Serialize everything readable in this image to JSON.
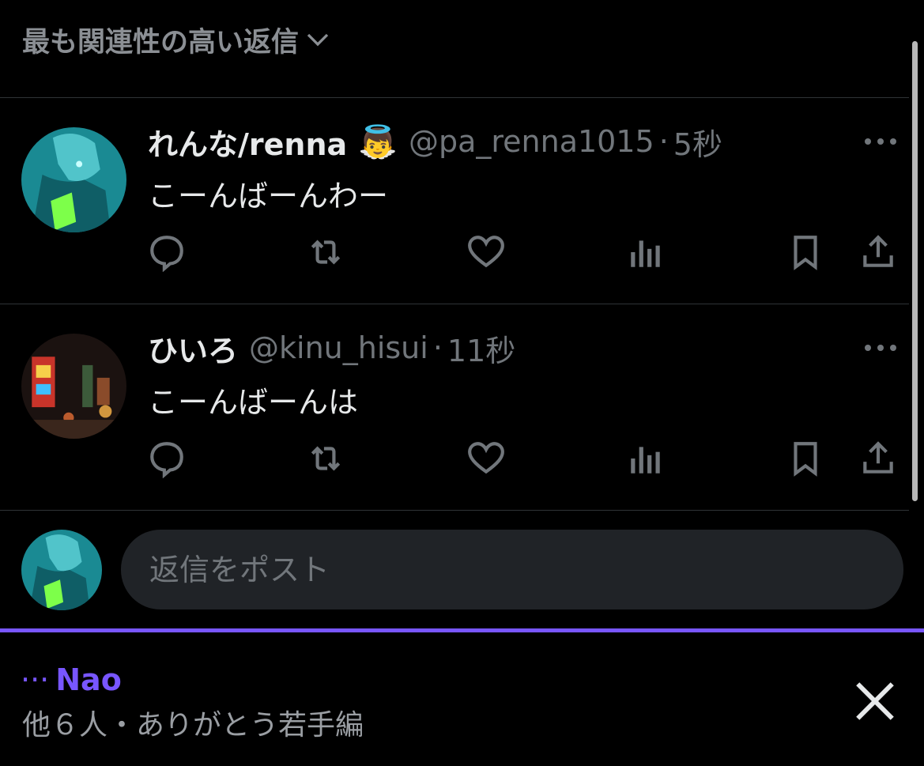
{
  "sort": {
    "label": "最も関連性の高い返信",
    "icon": "chevron-down-icon"
  },
  "tweets": [
    {
      "name": "れんな/renna",
      "emoji": "👼",
      "handle": "@pa_renna1015",
      "sep": "·",
      "time": "5秒",
      "text": "こーんばーんわー"
    },
    {
      "name": "ひいろ",
      "emoji": "",
      "handle": "@kinu_hisui",
      "sep": "·",
      "time": "11秒",
      "text": "こーんばーんは"
    }
  ],
  "reply": {
    "placeholder": "返信をポスト"
  },
  "notification": {
    "dots": "···",
    "name": "Nao",
    "subtitle": "他６人・ありがとう若手編"
  },
  "colors": {
    "accent": "#7856ff",
    "muted": "#71767b",
    "background": "#000000"
  }
}
